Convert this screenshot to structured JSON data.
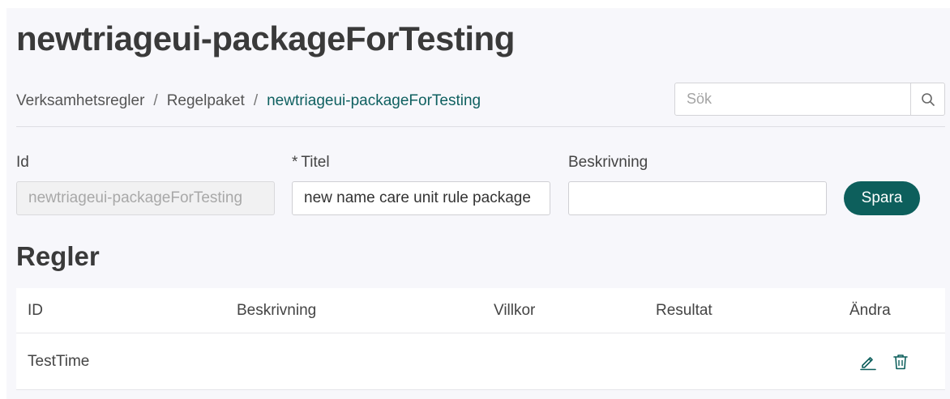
{
  "page": {
    "title": "newtriageui-packageForTesting"
  },
  "breadcrumb": {
    "items": [
      "Verksamhetsregler",
      "Regelpaket"
    ],
    "separator": "/",
    "current": "newtriageui-packageForTesting"
  },
  "search": {
    "placeholder": "Sök",
    "value": "",
    "icon": "search-icon"
  },
  "form": {
    "id_label": "Id",
    "id_value": "newtriageui-packageForTesting",
    "title_required_mark": "*",
    "title_label": "Titel",
    "title_value": "new name care unit rule package",
    "description_label": "Beskrivning",
    "description_value": "",
    "save_label": "Spara"
  },
  "rules": {
    "section_title": "Regler",
    "columns": [
      "ID",
      "Beskrivning",
      "Villkor",
      "Resultat",
      "Ändra"
    ],
    "rows": [
      {
        "id": "TestTime",
        "description": "",
        "condition": "",
        "result": "",
        "actions": [
          "edit-icon",
          "trash-icon"
        ]
      }
    ]
  },
  "colors": {
    "accent": "#0d5f5c",
    "link": "#0f6060",
    "background": "#f7f7fb"
  }
}
